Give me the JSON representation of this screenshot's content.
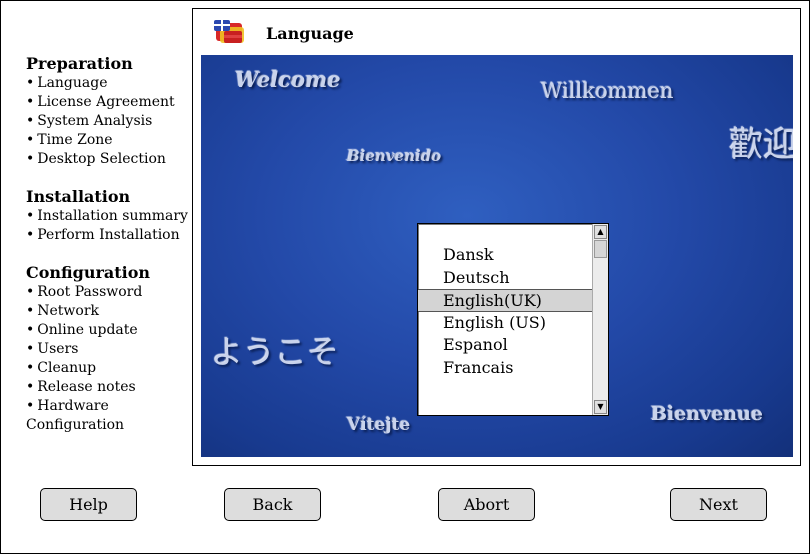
{
  "sidebar": {
    "sections": [
      {
        "title": "Preparation",
        "items": [
          "Language",
          "License Agreement",
          "System Analysis",
          "Time Zone",
          "Desktop Selection"
        ]
      },
      {
        "title": "Installation",
        "items": [
          "Installation summary",
          "Perform Installation"
        ]
      },
      {
        "title": "Configuration",
        "items": [
          "Root Password",
          "Network",
          "Online update",
          "Users",
          "Cleanup",
          "Release notes",
          "Hardware"
        ],
        "tail": "Configuration"
      }
    ],
    "bullet": "•"
  },
  "panel": {
    "title": "Language",
    "icon": "language-flags-icon"
  },
  "welcome_words": {
    "welcome": "Welcome",
    "willkommen": "Willkommen",
    "bienvenido": "Bienvenido",
    "kanji": "歡迎",
    "youkoso": "ようこそ",
    "vitejte": "Vítejte",
    "bienvenue": "Bienvenue"
  },
  "language_list": {
    "items": [
      "Dansk",
      "Deutsch",
      "English(UK)",
      "English (US)",
      "Espanol",
      "Francais"
    ],
    "selected": "English(UK)",
    "scroll_up": "▲",
    "scroll_down": "▼"
  },
  "buttons": {
    "help": "Help",
    "back": "Back",
    "abort": "Abort",
    "next": "Next"
  },
  "colors": {
    "background_blue": "#2349a8",
    "selection_gray": "#d4d4d4",
    "button_gray": "#dddddd"
  }
}
